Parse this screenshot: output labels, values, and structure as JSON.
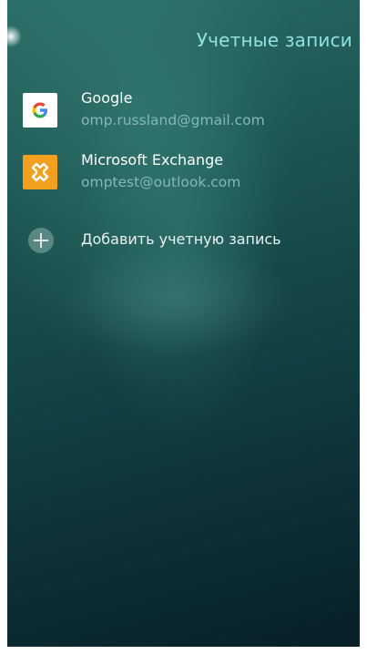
{
  "header": {
    "title": "Учетные записи"
  },
  "accounts": [
    {
      "name": "Google",
      "email": "omp.russland@gmail.com",
      "icon": "google-icon"
    },
    {
      "name": "Microsoft Exchange",
      "email": "omptest@outlook.com",
      "icon": "exchange-icon"
    }
  ],
  "add_account": {
    "label": "Добавить учетную запись",
    "icon": "plus-icon"
  },
  "colors": {
    "title_accent": "#8fe3dc",
    "secondary_text": "#86b8b6",
    "exchange_orange": "#f3a01f",
    "background_dark": "#0b2a31"
  }
}
